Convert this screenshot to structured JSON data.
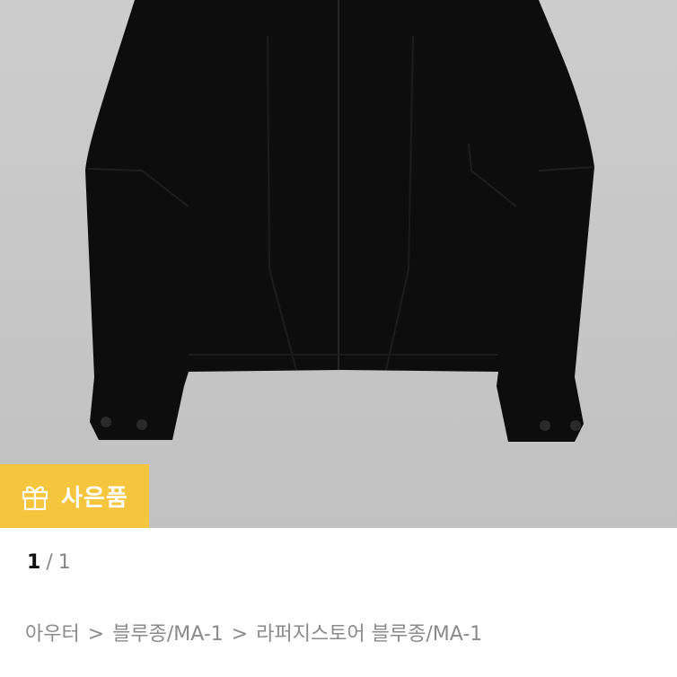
{
  "gift_badge": {
    "label": "사은품",
    "icon": "gift-icon",
    "background": "#f4c53d",
    "text_color": "#ffffff"
  },
  "pager": {
    "current": "1",
    "separator": "/",
    "total": "1"
  },
  "breadcrumb": {
    "separator": ">",
    "items": [
      "아우터",
      "블루종/MA-1",
      "라퍼지스토어 블루종/MA-1"
    ]
  },
  "colors": {
    "image_background": "#c6c6c6",
    "jacket": "#0c0c0c",
    "breadcrumb_text": "#8a8a8a"
  }
}
